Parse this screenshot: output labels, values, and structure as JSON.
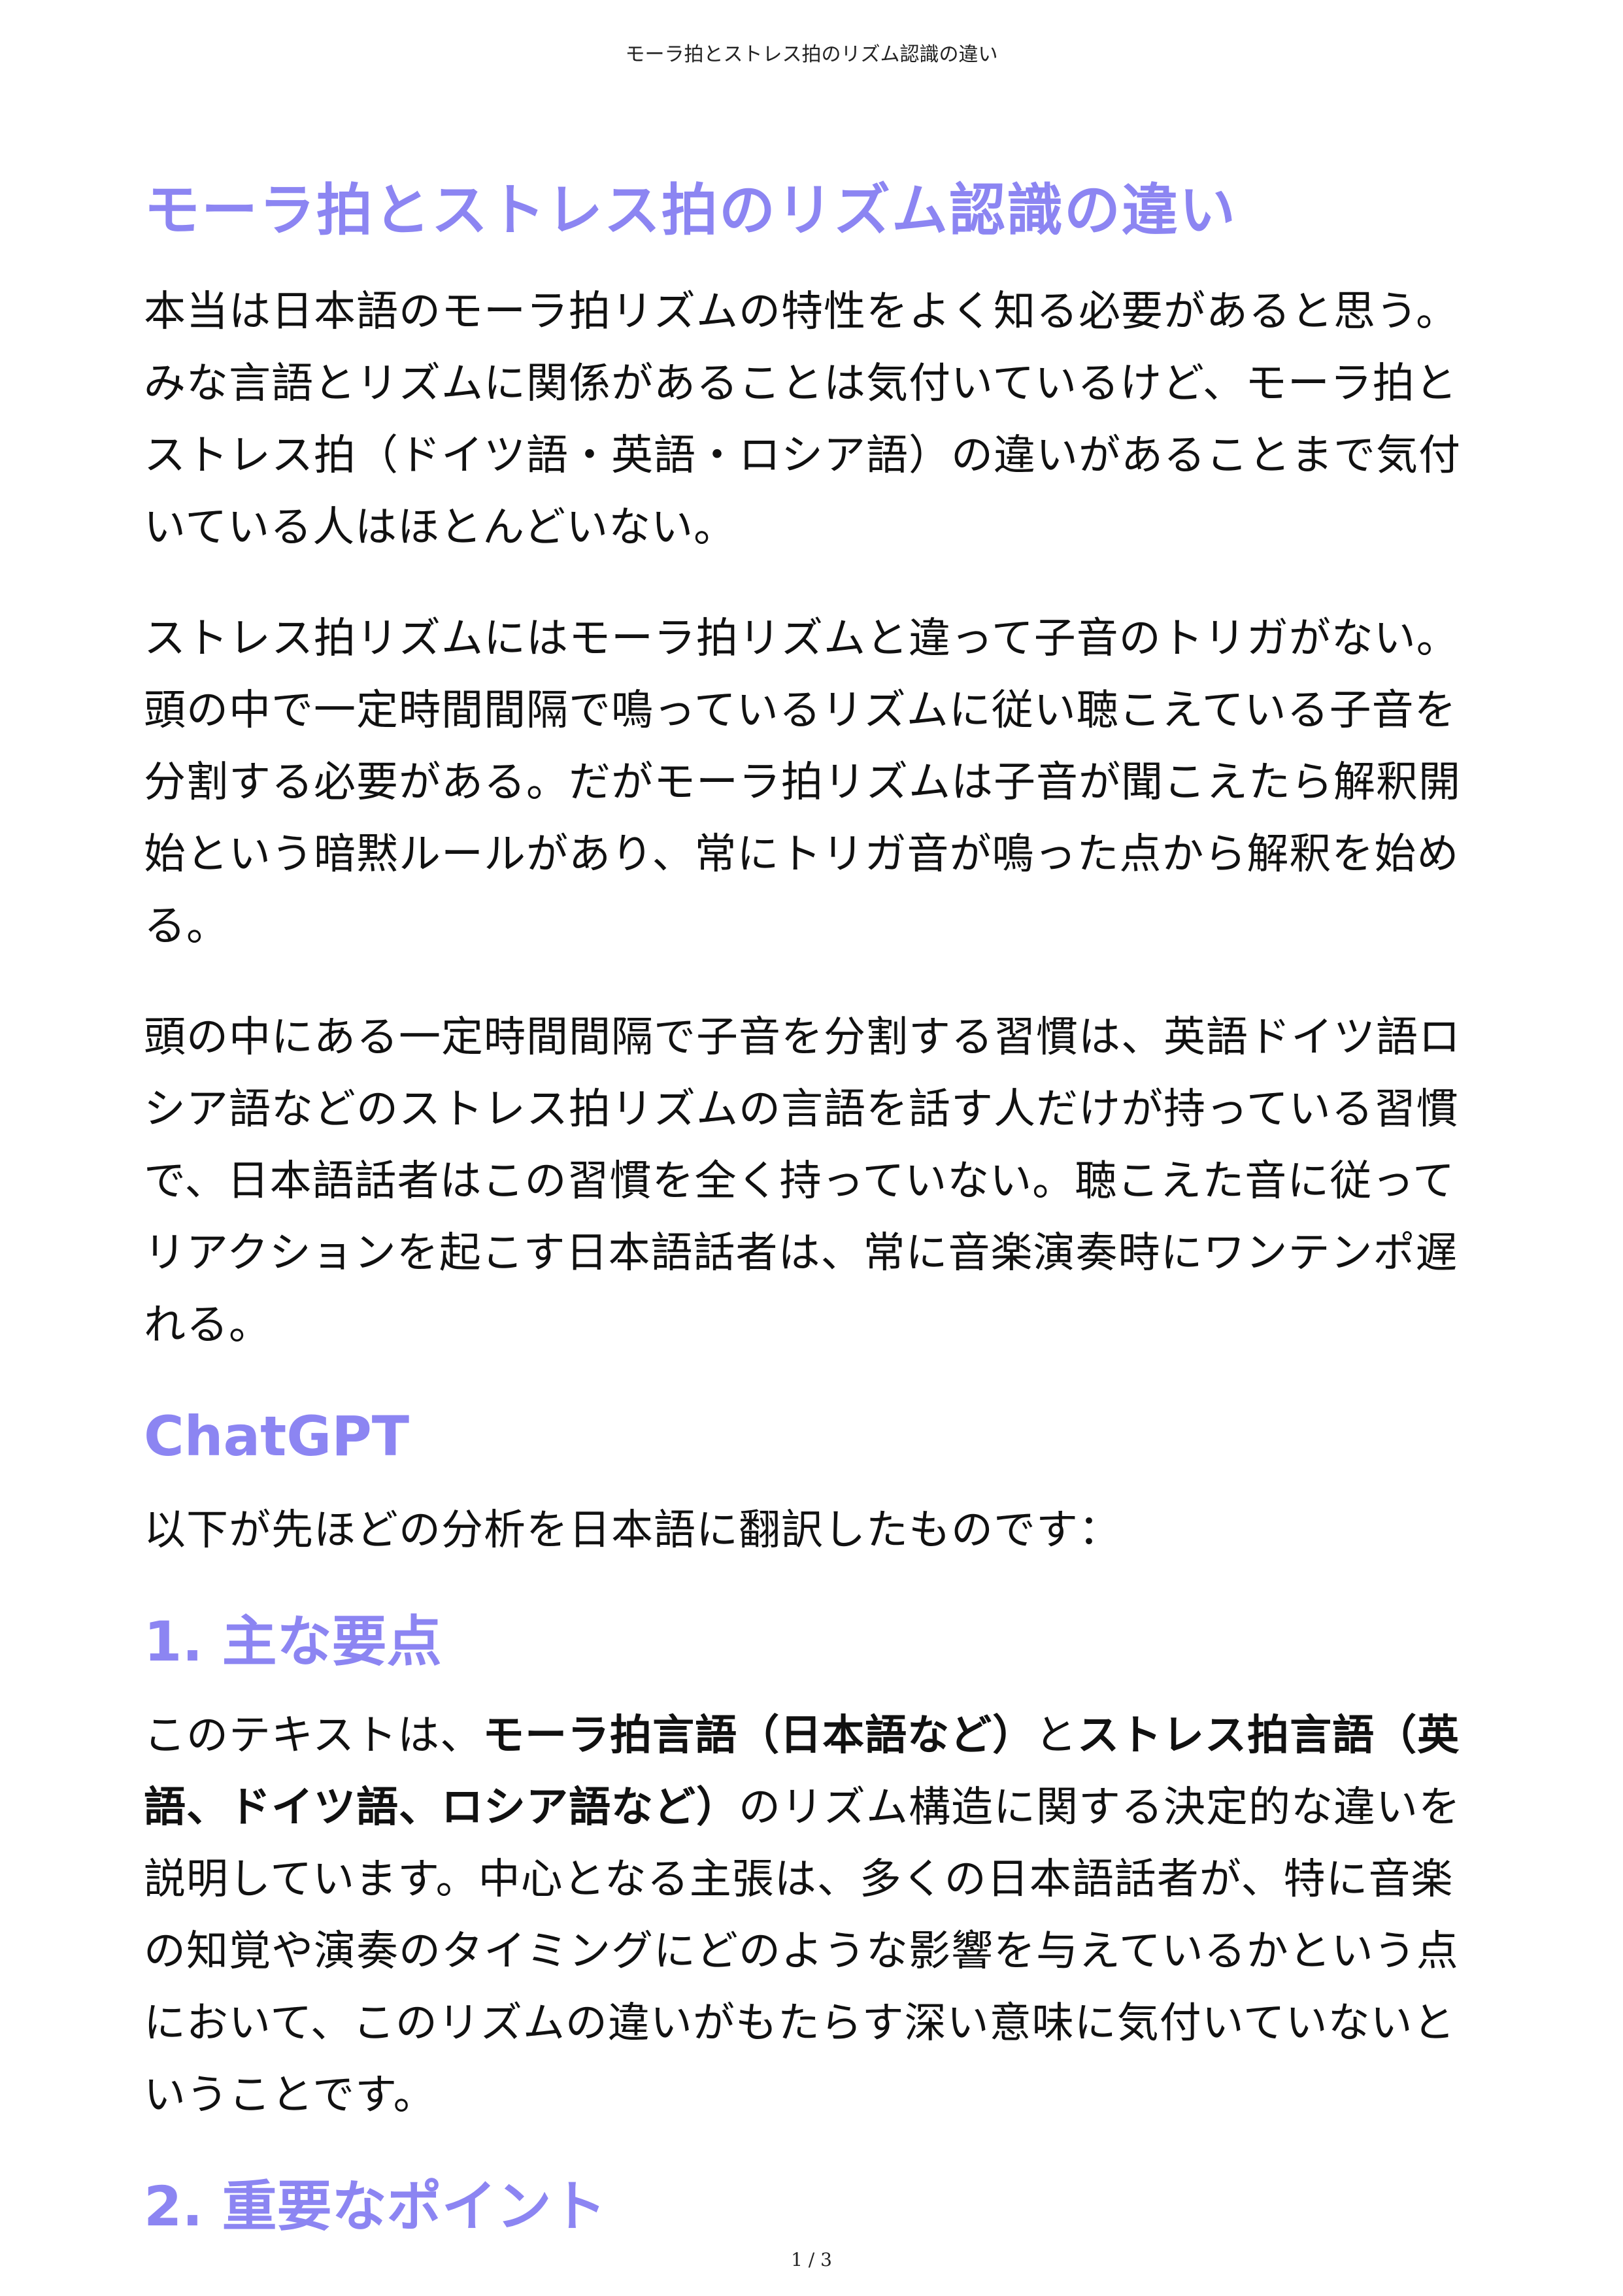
{
  "header": {
    "running_title": "モーラ拍とストレス拍のリズム認識の違い"
  },
  "title": "モーラ拍とストレス拍のリズム認識の違い",
  "paragraphs": [
    "本当は日本語のモーラ拍リズムの特性をよく知る必要があると思う。みな言語とリズムに関係があることは気付いているけど、モーラ拍とストレス拍（ドイツ語・英語・ロシア語）の違いがあることまで気付いている人はほとんどいない。",
    "ストレス拍リズムにはモーラ拍リズムと違って子音のトリガがない。頭の中で一定時間間隔で鳴っているリズムに従い聴こえている子音を分割する必要がある。だがモーラ拍リズムは子音が聞こえたら解釈開始という暗黙ルールがあり、常にトリガ音が鳴った点から解釈を始める。",
    "頭の中にある一定時間間隔で子音を分割する習慣は、英語ドイツ語ロシア語などのストレス拍リズムの言語を話す人だけが持っている習慣で、日本語話者はこの習慣を全く持っていない。聴こえた音に従ってリアクションを起こす日本語話者は、常に音楽演奏時にワンテンポ遅れる。"
  ],
  "chatgpt": {
    "heading": "ChatGPT",
    "intro": "以下が先ほどの分析を日本語に翻訳したものです："
  },
  "section1": {
    "heading": "1. 主な要点",
    "text_1": "このテキストは、",
    "bold_1": "モーラ拍言語（日本語など）",
    "text_2": "と",
    "bold_2": "ストレス拍言語（英語、ドイツ語、ロシア語など）",
    "text_3": "のリズム構造に関する決定的な違いを説明しています。中心となる主張は、多くの日本語話者が、特に音楽の知覚や演奏のタイミングにどのような影響を与えているかという点において、このリズムの違いがもたらす深い意味に気付いていないということです。"
  },
  "section2": {
    "heading": "2. 重要なポイント"
  },
  "footer": {
    "page_number": "1 / 3"
  }
}
